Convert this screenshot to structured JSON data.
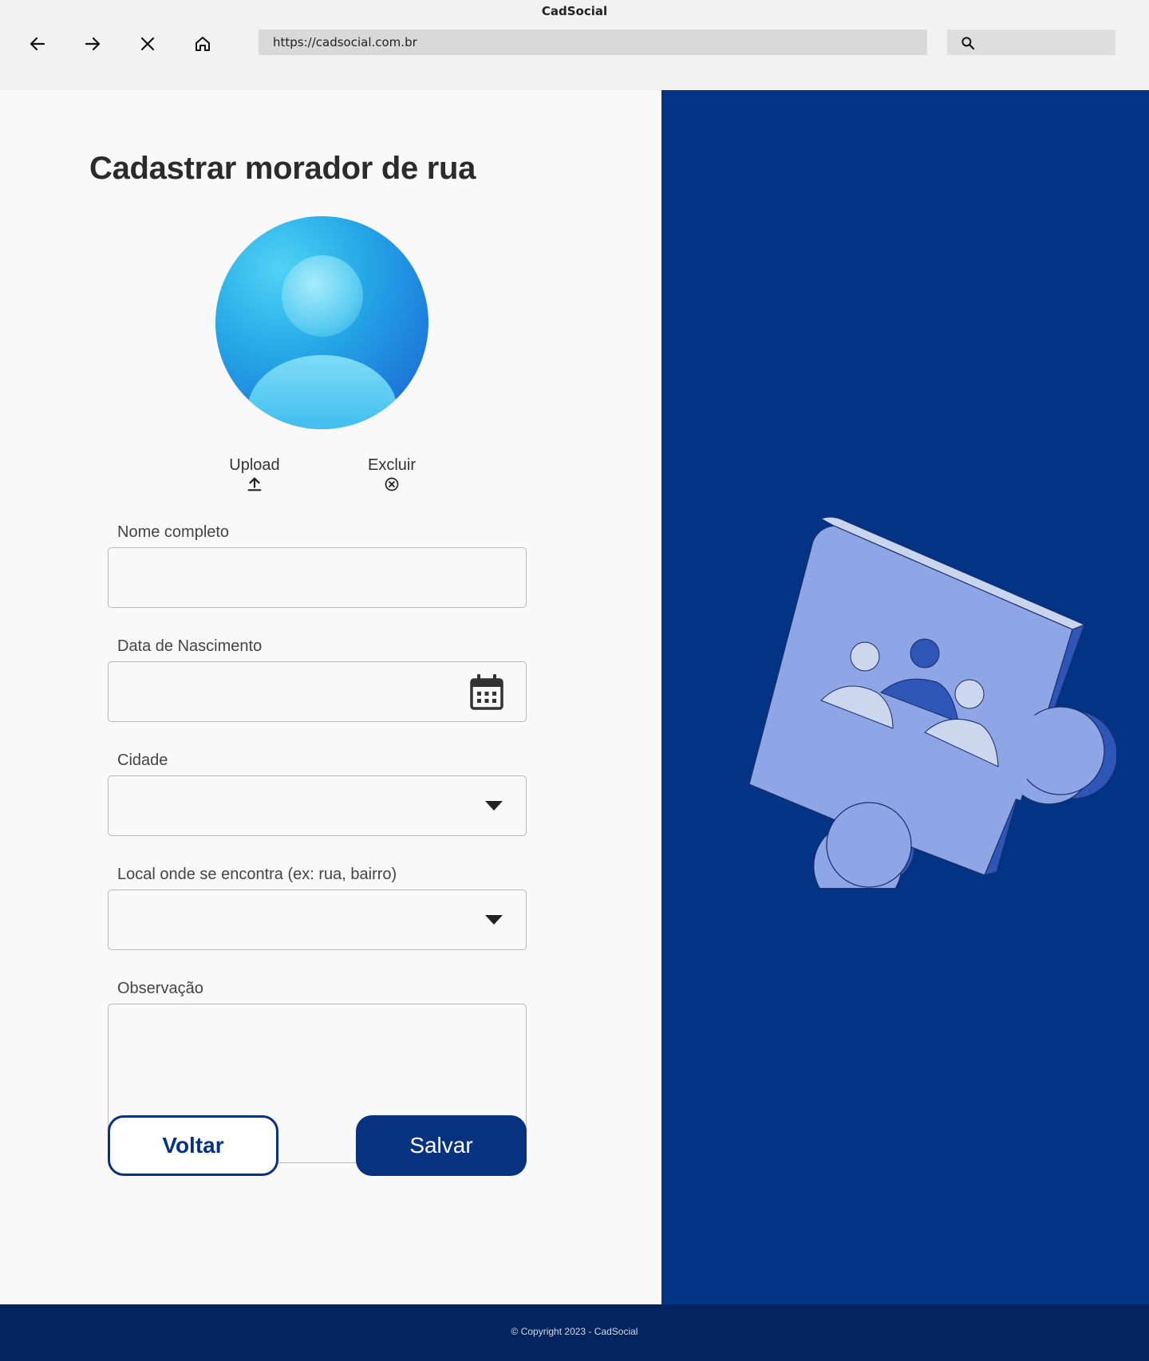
{
  "browser": {
    "window_title": "CadSocial",
    "url": "https://cadsocial.com.br",
    "nav_icons": [
      "back-arrow-icon",
      "forward-arrow-icon",
      "close-icon",
      "home-icon"
    ],
    "search_icon": "search-icon"
  },
  "form": {
    "title": "Cadastrar morador de rua",
    "avatar_icon": "user-avatar-icon",
    "upload_label": "Upload",
    "delete_label": "Excluir",
    "fields": {
      "name": {
        "label": "Nome completo",
        "value": ""
      },
      "birthdate": {
        "label": "Data de Nascimento",
        "value": "",
        "icon": "calendar-icon"
      },
      "city": {
        "label": "Cidade",
        "value": "",
        "icon": "dropdown-arrow-icon"
      },
      "location": {
        "label": "Local onde se encontra (ex: rua, bairro)",
        "value": "",
        "icon": "dropdown-arrow-icon"
      },
      "notes": {
        "label": "Observação",
        "value": ""
      }
    },
    "back_label": "Voltar",
    "save_label": "Salvar"
  },
  "illustration": {
    "icon": "puzzle-piece-community-icon"
  },
  "footer": {
    "copyright": "© Copyright 2023 - CadSocial"
  },
  "colors": {
    "primary": "#07327f",
    "panel": "#033384",
    "footer": "#03245e",
    "puzzle": "#8fa6e6"
  }
}
